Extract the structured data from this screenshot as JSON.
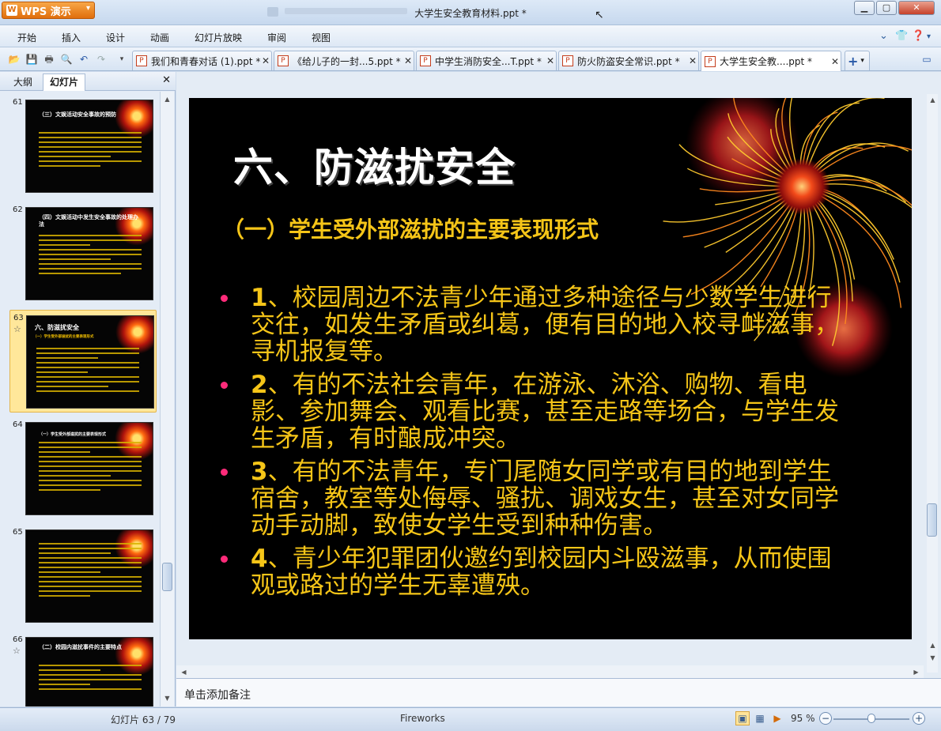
{
  "app": {
    "name": "WPS 演示",
    "window_title": "大学生安全教育材料.ppt *"
  },
  "menu": [
    "开始",
    "插入",
    "设计",
    "动画",
    "幻灯片放映",
    "审阅",
    "视图"
  ],
  "doc_tabs": [
    {
      "label": "我们和青春对话 (1).ppt *",
      "active": false
    },
    {
      "label": "《给儿子的一封...5.ppt *",
      "active": false
    },
    {
      "label": "中学生消防安全...T.ppt *",
      "active": false
    },
    {
      "label": "防火防盗安全常识.ppt *",
      "active": false
    },
    {
      "label": "大学生安全教....ppt *",
      "active": true
    }
  ],
  "left_pane": {
    "tabs": [
      "大纲",
      "幻灯片"
    ],
    "active_tab": "幻灯片",
    "thumbnails": [
      {
        "number": "61",
        "title": "（三）文娱活动安全事故的预防",
        "subtitle": "",
        "has_star": false,
        "active": false
      },
      {
        "number": "62",
        "title": "（四）文娱活动中发生安全事故的处理办法",
        "subtitle": "",
        "has_star": false,
        "active": false
      },
      {
        "number": "63",
        "title": "六、防滋扰安全",
        "subtitle": "（一）学生受外部滋扰的主要表现形式",
        "has_star": true,
        "active": true
      },
      {
        "number": "64",
        "title": "（一）学生受外部滋扰的主要表现形式",
        "subtitle": "",
        "has_star": false,
        "active": false
      },
      {
        "number": "65",
        "title": "",
        "subtitle": "",
        "has_star": false,
        "active": false
      },
      {
        "number": "66",
        "title": "（二）校园内滋扰事件的主要特点",
        "subtitle": "",
        "has_star": true,
        "active": false
      }
    ]
  },
  "slide": {
    "title": "六、防滋扰安全",
    "subtitle": "（一）学生受外部滋扰的主要表现形式",
    "bullets": [
      {
        "num": "1",
        "text": "、校园周边不法青少年通过多种途径与少数学生进行交往，如发生矛盾或纠葛，便有目的地入校寻衅滋事，寻机报复等。"
      },
      {
        "num": "2",
        "text": "、有的不法社会青年，在游泳、沐浴、购物、看电影、参加舞会、观看比赛，甚至走路等场合，与学生发生矛盾，有时酿成冲突。"
      },
      {
        "num": "3",
        "text": "、有的不法青年，专门尾随女同学或有目的地到学生宿舍，教室等处侮辱、骚扰、调戏女生，甚至对女同学动手动脚，致使女学生受到种种伤害。"
      },
      {
        "num": "4",
        "text": "、青少年犯罪团伙邀约到校园内斗殴滋事，从而使围观或路过的学生无辜遭殃。"
      }
    ]
  },
  "notes_placeholder": "单击添加备注",
  "status": {
    "slide_counter": "幻灯片 63 / 79",
    "theme": "Fireworks",
    "zoom": "95 %",
    "zoom_level": 0.5
  }
}
